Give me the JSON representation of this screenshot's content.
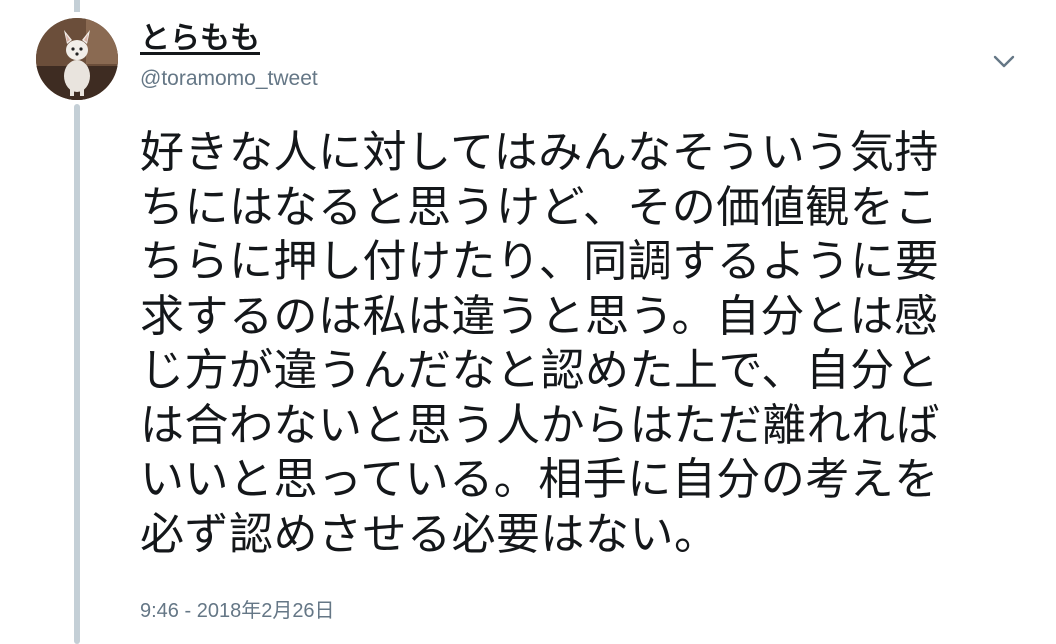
{
  "tweet": {
    "author": {
      "display_name": "とらもも",
      "handle": "@toramomo_tweet",
      "avatar_icon": "dog-photo-avatar"
    },
    "menu_icon": "chevron-down-icon",
    "text_lines": [
      "好きな人に対してはみんなそういう気持",
      "ちにはなると思うけど、その価値観をこ",
      "ちらに押し付けたり、同調するように要",
      "求するのは私は違うと思う。自分とは感",
      "じ方が違うんだなと認めた上で、自分と",
      "は合わないと思う人からはただ離れれば",
      "いいと思っている。相手に自分の考えを",
      "必ず認めさせる必要はない。"
    ],
    "timestamp": "9:46 - 2018年2月26日"
  },
  "colors": {
    "text": "#14171a",
    "secondary": "#657786",
    "thread_line": "#c4cfd6"
  }
}
